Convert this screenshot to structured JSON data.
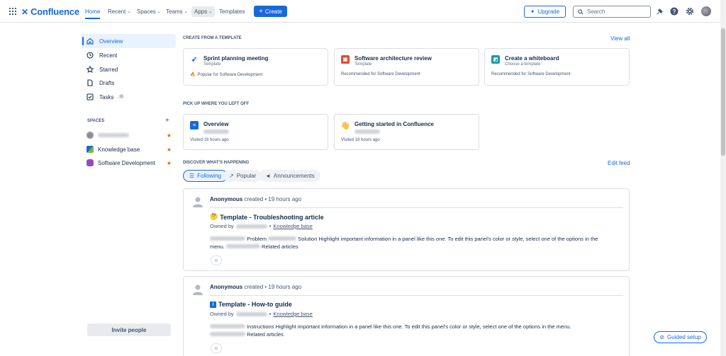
{
  "app": {
    "name": "Confluence"
  },
  "nav": {
    "home": "Home",
    "recent": "Recent",
    "spaces": "Spaces",
    "teams": "Teams",
    "apps": "Apps",
    "templates": "Templates",
    "create": "Create",
    "upgrade": "Upgrade",
    "search_placeholder": "Search"
  },
  "sidebar": {
    "items": [
      {
        "label": "Overview",
        "icon": "home-icon"
      },
      {
        "label": "Recent",
        "icon": "clock-icon"
      },
      {
        "label": "Starred",
        "icon": "star-outline-icon"
      },
      {
        "label": "Drafts",
        "icon": "document-icon"
      },
      {
        "label": "Tasks",
        "icon": "checkbox-icon",
        "count": "0"
      }
    ],
    "spaces_label": "SPACES",
    "spaces": [
      {
        "label": "",
        "icon": "personal-space-icon"
      },
      {
        "label": "Knowledge base",
        "icon": "knowledge-base-icon"
      },
      {
        "label": "Software Development",
        "icon": "software-dev-icon"
      }
    ],
    "invite": "Invite people"
  },
  "create_section": {
    "title": "CREATE FROM A TEMPLATE",
    "view_all": "View all",
    "cards": [
      {
        "title": "Sprint planning meeting",
        "sub": "Template",
        "foot": "Popular for Software Development"
      },
      {
        "title": "Software architecture review",
        "sub": "Template",
        "foot": "Recommended for Software Development"
      },
      {
        "title": "Create a whiteboard",
        "sub": "Choose a template",
        "foot": "Recommended for Software Development"
      }
    ]
  },
  "pickup_section": {
    "title": "PICK UP WHERE YOU LEFT OFF",
    "cards": [
      {
        "title": "Overview",
        "foot": "Visited 19 hours ago"
      },
      {
        "title": "Getting started in Confluence",
        "foot": "Visited 19 hours ago"
      }
    ]
  },
  "discover_section": {
    "title": "DISCOVER WHAT'S HAPPENING",
    "edit_feed": "Edit feed",
    "filters": [
      "Following",
      "Popular",
      "Announcements"
    ]
  },
  "feed": [
    {
      "author": "Anonymous",
      "action": "created",
      "time": "• 19 hours ago",
      "title": "Template - Troubleshooting article",
      "owned_by": "Owned by",
      "space": "Knowledge base",
      "body_1": "Problem",
      "body_2": "Solution Highlight important information in a panel like this one. To edit this panel's color or style, select one of the options in the",
      "body_3": "menu.",
      "body_4": "Related articles"
    },
    {
      "author": "Anonymous",
      "action": "created",
      "time": "• 19 hours ago",
      "title": "Template - How-to guide",
      "owned_by": "Owned by",
      "space": "Knowledge base",
      "body_1": "Instructions Highlight important information in a panel like this one. To edit this panel's color or style, select one of the options in the menu.",
      "body_2": "Related articles"
    }
  ],
  "guided_setup": "Guided setup"
}
